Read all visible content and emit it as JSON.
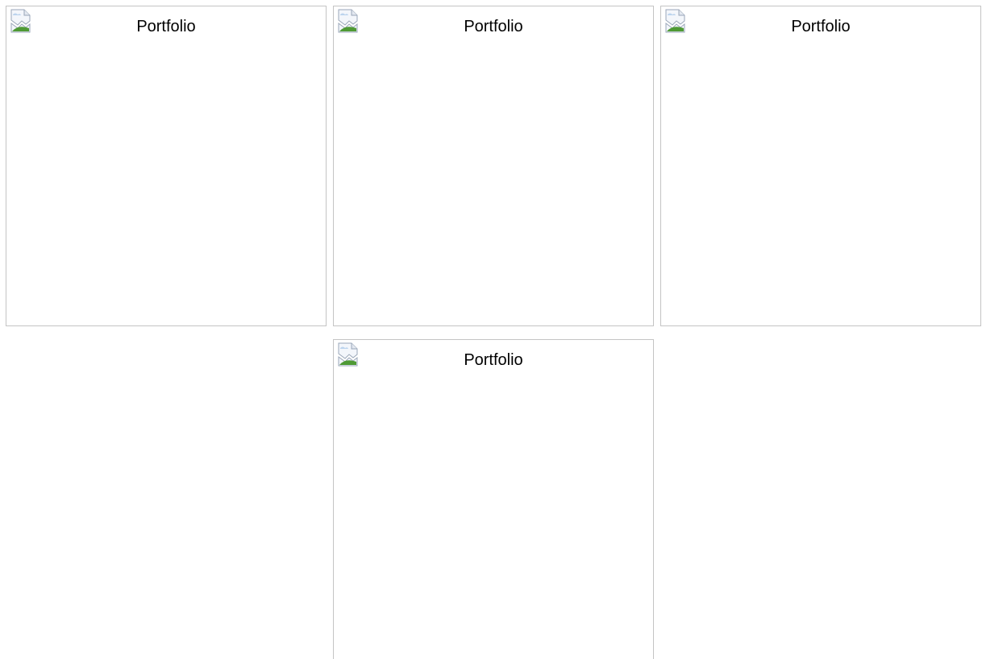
{
  "portfolio_items": [
    {
      "alt": "Portfolio",
      "icon": "broken-image-icon"
    },
    {
      "alt": "Portfolio",
      "icon": "broken-image-icon"
    },
    {
      "alt": "Portfolio",
      "icon": "broken-image-icon"
    },
    {
      "alt": "Portfolio",
      "icon": "broken-image-icon"
    }
  ],
  "colors": {
    "tile_border": "#c4c4c4",
    "background": "#ffffff",
    "text": "#000000"
  }
}
